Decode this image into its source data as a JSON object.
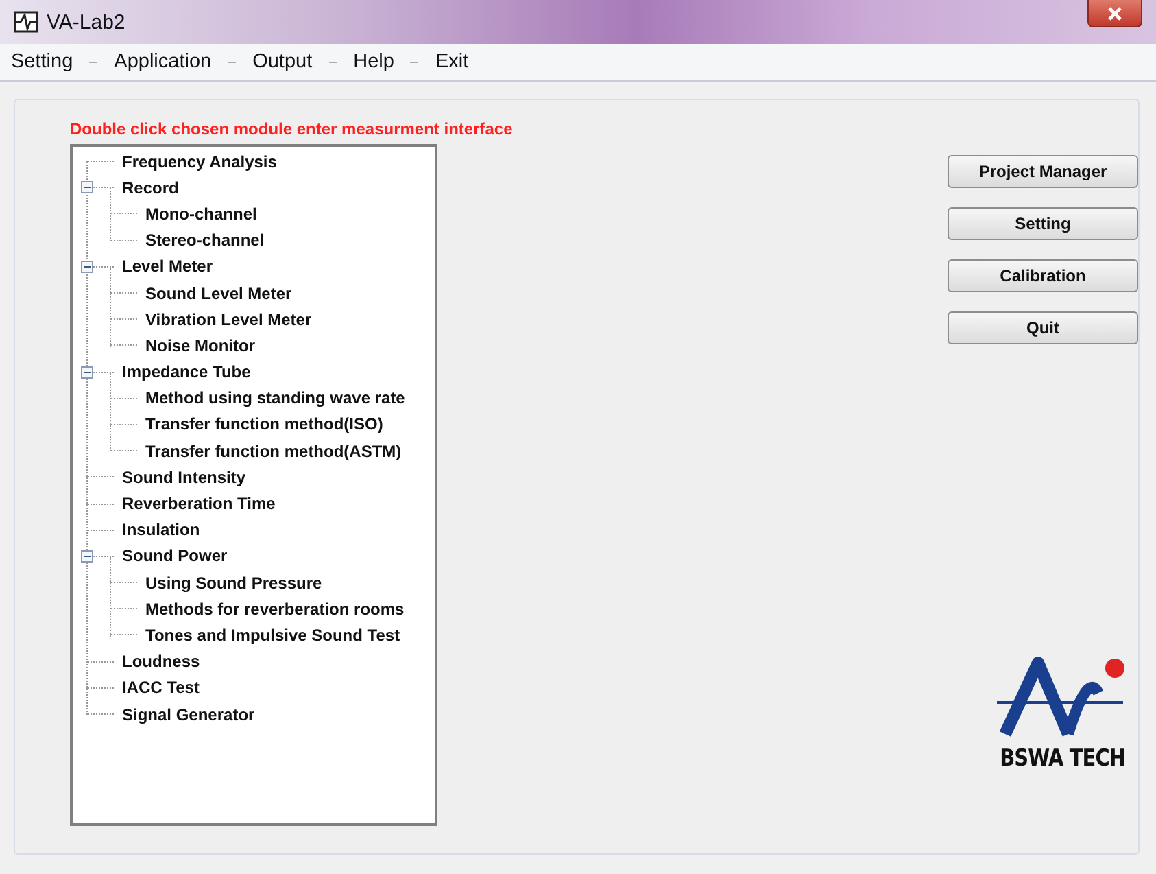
{
  "window": {
    "title": "VA-Lab2"
  },
  "menu": [
    "Setting",
    "Application",
    "Output",
    "Help",
    "Exit"
  ],
  "instruction": "Double click chosen module enter measurment interface",
  "tree": [
    {
      "label": "Frequency Analysis"
    },
    {
      "label": "Record",
      "expanded": true,
      "children": [
        {
          "label": "Mono-channel"
        },
        {
          "label": "Stereo-channel"
        }
      ]
    },
    {
      "label": "Level Meter",
      "expanded": true,
      "children": [
        {
          "label": "Sound Level Meter"
        },
        {
          "label": "Vibration Level Meter"
        },
        {
          "label": "Noise Monitor"
        }
      ]
    },
    {
      "label": "Impedance Tube",
      "expanded": true,
      "children": [
        {
          "label": "Method using standing wave rate"
        },
        {
          "label": "Transfer function method(ISO)"
        },
        {
          "label": "Transfer function method(ASTM)"
        }
      ]
    },
    {
      "label": "Sound Intensity"
    },
    {
      "label": "Reverberation Time"
    },
    {
      "label": "Insulation"
    },
    {
      "label": "Sound Power",
      "expanded": true,
      "children": [
        {
          "label": "Using Sound Pressure"
        },
        {
          "label": "Methods for reverberation rooms"
        },
        {
          "label": "Tones and Impulsive Sound Test"
        }
      ]
    },
    {
      "label": "Loudness"
    },
    {
      "label": "IACC Test"
    },
    {
      "label": "Signal Generator"
    }
  ],
  "buttons": [
    "Project Manager",
    "Setting",
    "Calibration",
    "Quit"
  ],
  "logo": {
    "text": "BSWA TECH"
  }
}
